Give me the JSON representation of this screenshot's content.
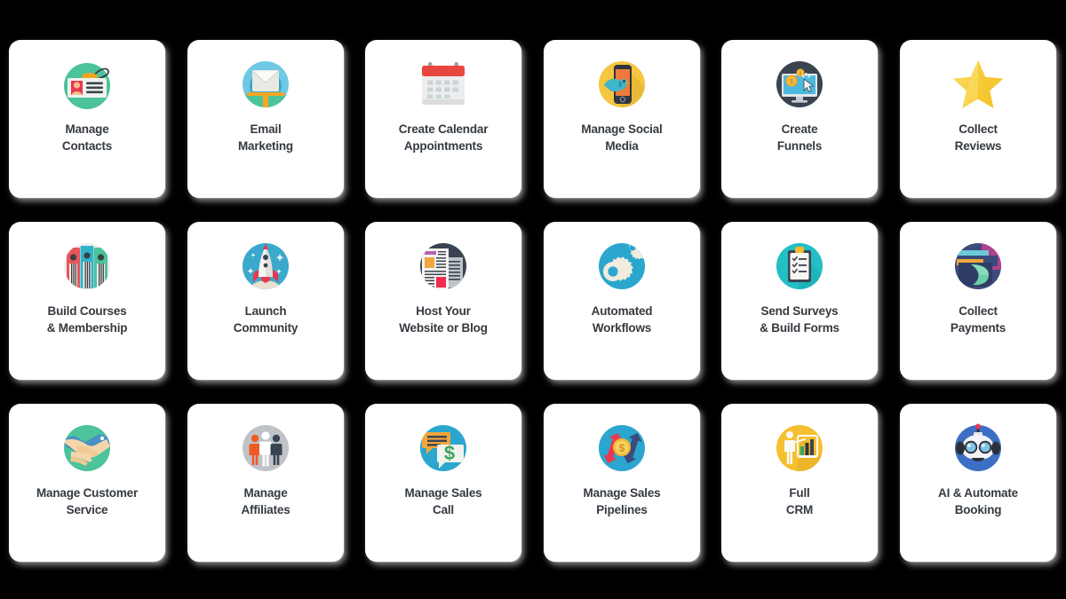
{
  "layout": {
    "columns": 6,
    "rows": 3,
    "background_color": "#000000",
    "card_color": "#ffffff",
    "label_color": "#343a40"
  },
  "cards": [
    {
      "id": "manage-contacts",
      "label": "Manage\nContacts",
      "icon": "id-badge-contact-card-icon",
      "accent": "#4CC39A"
    },
    {
      "id": "email-marketing",
      "label": "Email\nMarketing",
      "icon": "envelope-mail-icon",
      "accent": "#43B5D6"
    },
    {
      "id": "create-calendar-appointments",
      "label": "Create Calendar\nAppointments",
      "icon": "calendar-icon",
      "accent": "#E8473F"
    },
    {
      "id": "manage-social-media",
      "label": "Manage Social\nMedia",
      "icon": "phone-bird-social-icon",
      "accent": "#F5C842"
    },
    {
      "id": "create-funnels",
      "label": "Create\nFunnels",
      "icon": "monitor-coins-click-icon",
      "accent": "#3A4451"
    },
    {
      "id": "collect-reviews",
      "label": "Collect\nReviews",
      "icon": "star-icon",
      "accent": "#F7D046"
    },
    {
      "id": "build-courses-membership",
      "label": "Build Courses\n& Membership",
      "icon": "binders-books-icon",
      "accent": "#E85C5C"
    },
    {
      "id": "launch-community",
      "label": "Launch\nCommunity",
      "icon": "rocket-icon",
      "accent": "#3BA9CB"
    },
    {
      "id": "host-website-blog",
      "label": "Host Your\nWebsite or Blog",
      "icon": "newspaper-blog-icon",
      "accent": "#3A4451"
    },
    {
      "id": "automated-workflows",
      "label": "Automated\nWorkflows",
      "icon": "globe-gears-icon",
      "accent": "#2BA6CE"
    },
    {
      "id": "send-surveys-build-forms",
      "label": "Send Surveys\n& Build Forms",
      "icon": "clipboard-checklist-icon",
      "accent": "#22BFC4"
    },
    {
      "id": "collect-payments",
      "label": "Collect\nPayments",
      "icon": "wallet-money-icon",
      "accent": "#3A4B7C"
    },
    {
      "id": "manage-customer-service",
      "label": "Manage Customer\nService",
      "icon": "handshake-icon",
      "accent": "#4CC39A"
    },
    {
      "id": "manage-affiliates",
      "label": "Manage\nAffiliates",
      "icon": "people-group-icon",
      "accent": "#BCC0C4"
    },
    {
      "id": "manage-sales-call",
      "label": "Manage Sales\nCall",
      "icon": "chat-bubbles-dollar-icon",
      "accent": "#2BA6CE"
    },
    {
      "id": "manage-sales-pipelines",
      "label": "Manage Sales\nPipelines",
      "icon": "coin-arrows-exchange-icon",
      "accent": "#2BA6CE"
    },
    {
      "id": "full-crm",
      "label": "Full\nCRM",
      "icon": "presenter-chart-icon",
      "accent": "#F5C030"
    },
    {
      "id": "ai-automate-booking",
      "label": "AI & Automate\nBooking",
      "icon": "robot-icon",
      "accent": "#3C6FC4"
    }
  ]
}
